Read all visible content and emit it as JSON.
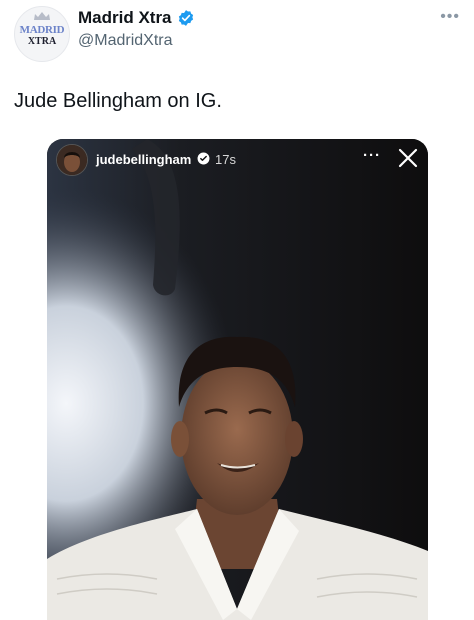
{
  "tweet": {
    "display_name": "Madrid Xtra",
    "handle": "@MadridXtra",
    "avatar_text_line1": "MADRID",
    "avatar_text_line2": "XTRA",
    "more_icon": "more-horizontal-icon",
    "text": "Jude Bellingham on IG."
  },
  "story": {
    "username": "judebellingham",
    "time": "17s",
    "more": "···",
    "close_icon": "close-icon"
  },
  "colors": {
    "verified_blue": "#1d9bf0",
    "handle_gray": "#536471"
  }
}
